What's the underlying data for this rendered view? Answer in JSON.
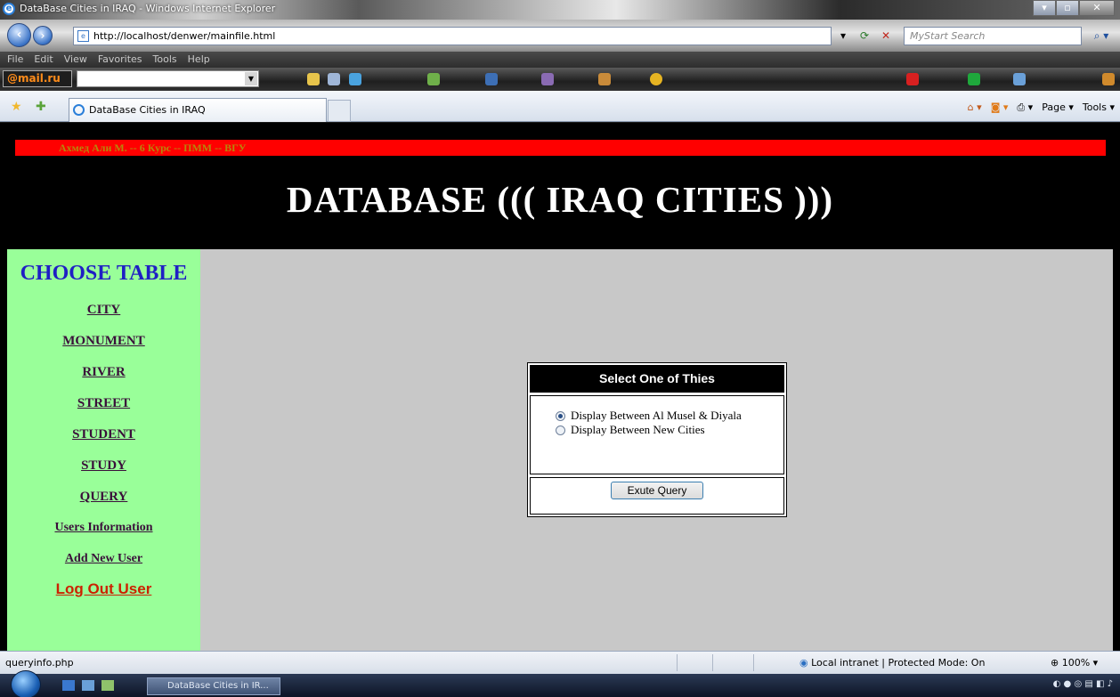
{
  "browser": {
    "window_title": "DataBase Cities in IRAQ - Windows Internet Explorer",
    "address": "http://localhost/denwer/mainfile.html",
    "search_placeholder": "MyStart Search",
    "menu": [
      "File",
      "Edit",
      "View",
      "Favorites",
      "Tools",
      "Help"
    ],
    "toolbar_brand": "@mail.ru",
    "tab_label": "DataBase Cities in IRAQ",
    "command_bar": [
      "Page ▾",
      "Tools ▾"
    ],
    "status_url": "queryinfo.php",
    "status_zone": "Local intranet | Protected Mode: On",
    "zoom": "100%",
    "taskbar_item": "DataBase Cities in IR..."
  },
  "header": {
    "author_line": "Ахмед Али М. -- 6 Курс -- ПММ -- ВГУ",
    "title": "DATABASE ((( IRAQ CITIES )))"
  },
  "sidebar": {
    "heading": "CHOOSE TABLE",
    "links": [
      "CITY",
      "MONUMENT",
      "RIVER",
      "STREET",
      "STUDENT",
      "STUDY",
      "QUERY",
      "Users Information",
      "Add New User"
    ],
    "logout": "Log Out User"
  },
  "query_box": {
    "heading": "Select One of Thies",
    "options": [
      "Display Between Al Musel & Diyala",
      "Display Between New Cities"
    ],
    "selected_index": 0,
    "button": "Exute Query"
  },
  "colors": {
    "header_bg": "#000000",
    "author_bar": "#ff0000",
    "sidebar_bg": "#99ff99",
    "content_bg": "#c8c8c8",
    "heading_blue": "#1f1fc4",
    "logout_red": "#cc2200"
  }
}
